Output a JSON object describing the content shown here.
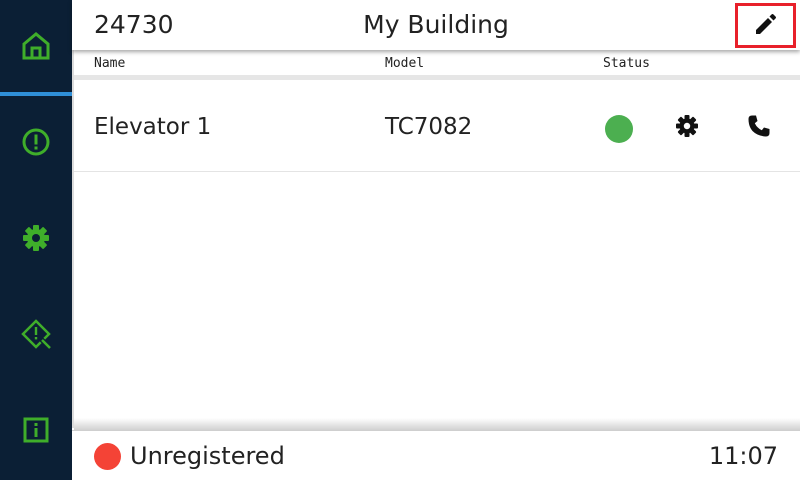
{
  "header": {
    "building_id": "24730",
    "building_name": "My Building",
    "edit_icon": "pencil-icon"
  },
  "sidebar": {
    "items": [
      {
        "name": "home",
        "icon": "home-icon",
        "active": true
      },
      {
        "name": "alerts",
        "icon": "alert-circle-icon",
        "active": false
      },
      {
        "name": "settings",
        "icon": "gear-icon",
        "active": false
      },
      {
        "name": "diagnostics",
        "icon": "warning-search-icon",
        "active": false
      },
      {
        "name": "info",
        "icon": "info-icon",
        "active": false
      }
    ]
  },
  "columns": {
    "name": "Name",
    "model": "Model",
    "status": "Status"
  },
  "rows": [
    {
      "name": "Elevator 1",
      "model": "TC7082",
      "status_color": "#4caf50",
      "settings_icon": "gear-icon",
      "call_icon": "phone-icon"
    }
  ],
  "footer": {
    "registration_status": "Unregistered",
    "registration_color": "#f44336",
    "time": "11:07"
  },
  "colors": {
    "sidebar_bg": "#0b1f35",
    "accent_green": "#3fae2a",
    "active_indicator": "#2f8fd8",
    "highlight_red": "#e8202a"
  }
}
